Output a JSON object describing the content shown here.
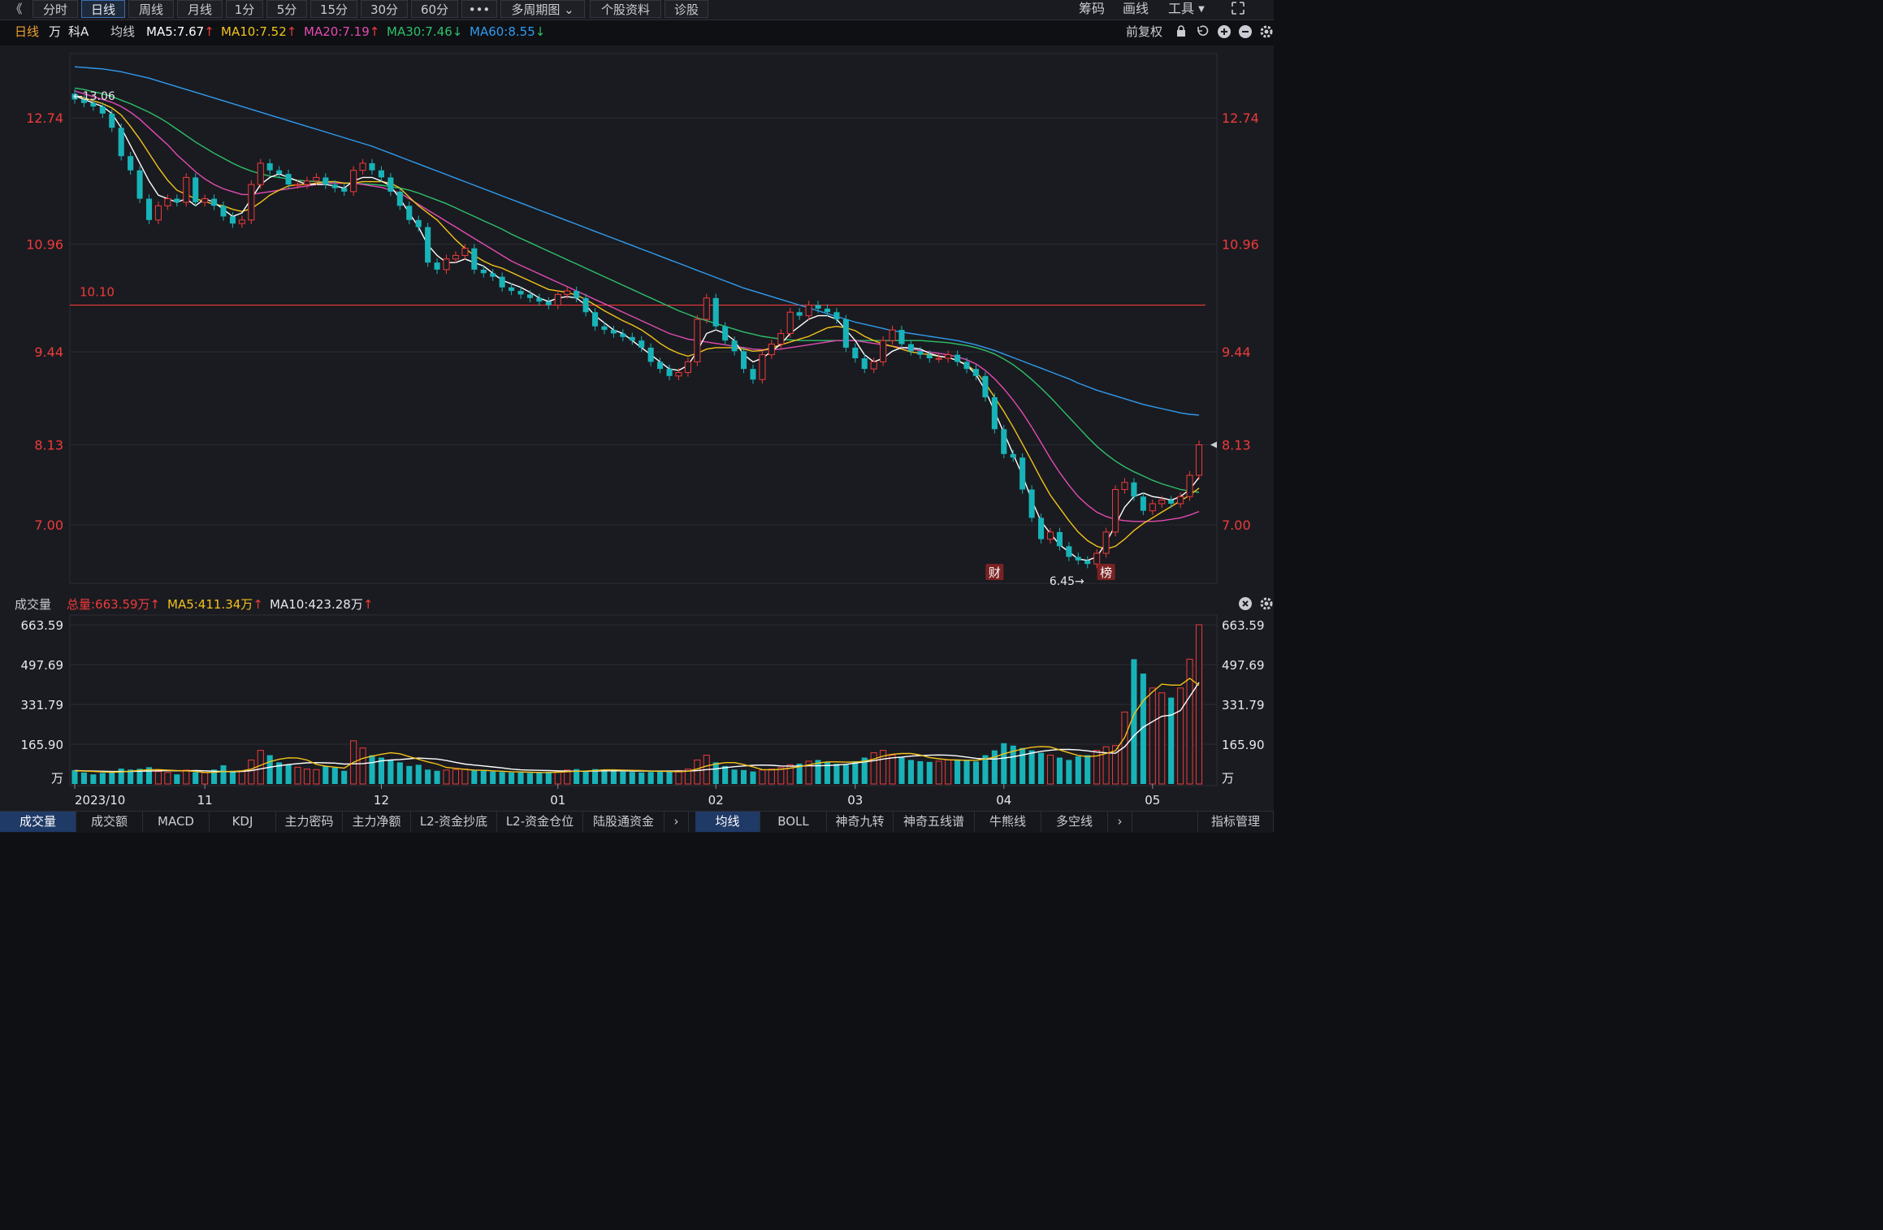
{
  "top_tabs": {
    "collapse": "《",
    "items": [
      "分时",
      "日线",
      "周线",
      "月线",
      "1分",
      "5分",
      "15分",
      "30分",
      "60分",
      "•••",
      "多周期图 ⌄",
      "个股资料",
      "诊股"
    ],
    "active": "日线"
  },
  "top_right": {
    "chip": "筹码",
    "draw": "画线",
    "tools": "工具",
    "expand_icon": "expand-icon"
  },
  "legend": {
    "period": "日线",
    "unit": "万",
    "stock": "科A",
    "ma_label": "均线",
    "ma5": "MA5:7.67",
    "ma10": "MA10:7.52",
    "ma20": "MA20:7.19",
    "ma30": "MA30:7.46",
    "ma60": "MA60:8.55",
    "fq": "前复权"
  },
  "colors": {
    "up": "#ee3b3b",
    "down": "#18b3b8",
    "ma5": "#ffffff",
    "ma10": "#f2c21c",
    "ma20": "#e24bb3",
    "ma30": "#2ec06a",
    "ma60": "#2f9bf0",
    "grid": "#2a2c33",
    "axis_label": "#ee3b3b",
    "bg": "#1a1b20"
  },
  "price_axis": {
    "ticks": [
      "12.74",
      "10.96",
      "9.44",
      "8.13",
      "7.00"
    ]
  },
  "annotations": {
    "high": "←13.06",
    "low": "6.45→",
    "hline": "10.10",
    "marker_cai": "财",
    "marker_bang": "榜"
  },
  "volume_legend": {
    "title": "成交量",
    "total": "总量:663.59万",
    "ma5": "MA5:411.34万",
    "ma10": "MA10:423.28万"
  },
  "volume_axis": {
    "ticks": [
      "663.59",
      "497.69",
      "331.79",
      "165.90",
      "万"
    ]
  },
  "date_axis": [
    "2023/10",
    "11",
    "12",
    "01",
    "02",
    "03",
    "04",
    "05"
  ],
  "bottom_left_tabs": [
    "成交量",
    "成交额",
    "MACD",
    "KDJ",
    "主力密码",
    "主力净额",
    "L2-资金抄底",
    "L2-资金仓位",
    "陆股通资金"
  ],
  "bottom_right_tabs": [
    "均线",
    "BOLL",
    "神奇九转",
    "神奇五线谱",
    "牛熊线",
    "多空线"
  ],
  "bottom_extra": "指标管理",
  "chart_data": {
    "type": "candlestick",
    "price_ylim": [
      6.2,
      13.6
    ],
    "volume_ylim": [
      0,
      663.59
    ],
    "hline": 10.1,
    "closes": [
      13.0,
      12.95,
      12.9,
      12.8,
      12.6,
      12.2,
      12.0,
      11.6,
      11.3,
      11.5,
      11.6,
      11.55,
      11.9,
      11.55,
      11.6,
      11.5,
      11.35,
      11.25,
      11.3,
      11.8,
      12.1,
      12.0,
      11.95,
      11.8,
      11.8,
      11.85,
      11.9,
      11.8,
      11.75,
      11.7,
      12.0,
      12.1,
      12.0,
      11.9,
      11.7,
      11.5,
      11.3,
      11.2,
      10.7,
      10.6,
      10.75,
      10.8,
      10.9,
      10.6,
      10.55,
      10.5,
      10.35,
      10.3,
      10.25,
      10.2,
      10.15,
      10.1,
      10.25,
      10.3,
      10.2,
      10.0,
      9.8,
      9.75,
      9.7,
      9.65,
      9.6,
      9.5,
      9.3,
      9.2,
      9.1,
      9.15,
      9.3,
      9.9,
      10.2,
      9.8,
      9.6,
      9.45,
      9.2,
      9.05,
      9.4,
      9.55,
      9.7,
      10.0,
      9.95,
      10.1,
      10.05,
      10.0,
      9.9,
      9.5,
      9.35,
      9.2,
      9.3,
      9.6,
      9.75,
      9.55,
      9.45,
      9.4,
      9.35,
      9.35,
      9.4,
      9.3,
      9.2,
      9.1,
      8.8,
      8.35,
      8.0,
      7.95,
      7.5,
      7.1,
      6.8,
      6.9,
      6.7,
      6.55,
      6.5,
      6.45,
      6.6,
      6.9,
      7.5,
      7.6,
      7.4,
      7.2,
      7.3,
      7.35,
      7.3,
      7.4,
      7.7,
      8.13
    ],
    "volumes": [
      58,
      48,
      40,
      46,
      54,
      64,
      60,
      63,
      70,
      52,
      48,
      40,
      58,
      49,
      47,
      60,
      78,
      55,
      52,
      100,
      140,
      120,
      90,
      80,
      70,
      62,
      60,
      75,
      68,
      55,
      180,
      150,
      120,
      110,
      100,
      90,
      75,
      80,
      60,
      55,
      58,
      60,
      62,
      56,
      55,
      52,
      50,
      48,
      48,
      46,
      47,
      48,
      52,
      58,
      62,
      55,
      62,
      60,
      58,
      52,
      50,
      48,
      50,
      52,
      55,
      56,
      62,
      100,
      120,
      90,
      75,
      60,
      58,
      52,
      58,
      62,
      68,
      80,
      85,
      95,
      100,
      90,
      84,
      80,
      95,
      110,
      130,
      140,
      120,
      110,
      100,
      95,
      92,
      95,
      100,
      102,
      98,
      94,
      120,
      140,
      170,
      160,
      150,
      140,
      130,
      120,
      110,
      100,
      115,
      120,
      140,
      155,
      160,
      300,
      520,
      460,
      400,
      380,
      360,
      400,
      520,
      663.59
    ],
    "ma5": [
      13.05,
      13.0,
      12.95,
      12.9,
      12.8,
      12.6,
      12.35,
      12.1,
      11.85,
      11.65,
      11.6,
      11.55,
      11.6,
      11.5,
      11.6,
      11.55,
      11.45,
      11.35,
      11.4,
      11.6,
      11.8,
      11.9,
      11.95,
      11.9,
      11.85,
      11.8,
      11.8,
      11.8,
      11.78,
      11.75,
      11.85,
      11.9,
      11.9,
      11.85,
      11.78,
      11.6,
      11.4,
      11.2,
      10.95,
      10.8,
      10.7,
      10.7,
      10.75,
      10.7,
      10.65,
      10.55,
      10.45,
      10.4,
      10.35,
      10.28,
      10.2,
      10.15,
      10.2,
      10.22,
      10.2,
      10.1,
      9.95,
      9.85,
      9.75,
      9.7,
      9.6,
      9.5,
      9.4,
      9.3,
      9.2,
      9.18,
      9.25,
      9.45,
      9.7,
      9.75,
      9.7,
      9.6,
      9.4,
      9.3,
      9.35,
      9.45,
      9.55,
      9.7,
      9.8,
      9.9,
      9.95,
      9.95,
      9.9,
      9.75,
      9.6,
      9.4,
      9.3,
      9.35,
      9.45,
      9.5,
      9.5,
      9.48,
      9.42,
      9.38,
      9.36,
      9.32,
      9.25,
      9.12,
      8.9,
      8.6,
      8.3,
      8.0,
      7.7,
      7.35,
      7.05,
      6.88,
      6.72,
      6.62,
      6.52,
      6.5,
      6.55,
      6.75,
      7.0,
      7.25,
      7.4,
      7.45,
      7.4,
      7.38,
      7.35,
      7.4,
      7.5,
      7.67
    ],
    "ma10": [
      13.06,
      13.02,
      12.98,
      12.94,
      12.88,
      12.78,
      12.62,
      12.44,
      12.24,
      12.04,
      11.86,
      11.72,
      11.66,
      11.6,
      11.56,
      11.52,
      11.5,
      11.45,
      11.42,
      11.46,
      11.55,
      11.65,
      11.72,
      11.78,
      11.8,
      11.8,
      11.82,
      11.84,
      11.84,
      11.82,
      11.82,
      11.84,
      11.84,
      11.84,
      11.82,
      11.75,
      11.62,
      11.5,
      11.4,
      11.3,
      11.16,
      11.02,
      10.9,
      10.8,
      10.72,
      10.66,
      10.62,
      10.56,
      10.5,
      10.44,
      10.38,
      10.32,
      10.3,
      10.28,
      10.24,
      10.18,
      10.1,
      10.02,
      9.95,
      9.88,
      9.82,
      9.75,
      9.66,
      9.56,
      9.48,
      9.42,
      9.38,
      9.42,
      9.48,
      9.5,
      9.5,
      9.5,
      9.48,
      9.45,
      9.46,
      9.5,
      9.54,
      9.58,
      9.62,
      9.66,
      9.72,
      9.78,
      9.8,
      9.78,
      9.74,
      9.66,
      9.6,
      9.55,
      9.52,
      9.48,
      9.44,
      9.42,
      9.4,
      9.38,
      9.36,
      9.32,
      9.26,
      9.16,
      9.0,
      8.8,
      8.6,
      8.38,
      8.14,
      7.9,
      7.65,
      7.42,
      7.24,
      7.06,
      6.9,
      6.78,
      6.7,
      6.66,
      6.7,
      6.8,
      6.92,
      7.02,
      7.1,
      7.18,
      7.26,
      7.34,
      7.42,
      7.52
    ],
    "ma20": [
      13.12,
      13.08,
      13.04,
      13.0,
      12.96,
      12.9,
      12.82,
      12.72,
      12.6,
      12.48,
      12.36,
      12.22,
      12.1,
      11.98,
      11.88,
      11.8,
      11.74,
      11.7,
      11.66,
      11.66,
      11.68,
      11.7,
      11.72,
      11.74,
      11.76,
      11.78,
      11.8,
      11.82,
      11.82,
      11.82,
      11.82,
      11.8,
      11.78,
      11.76,
      11.72,
      11.68,
      11.6,
      11.52,
      11.44,
      11.36,
      11.28,
      11.2,
      11.12,
      11.04,
      10.96,
      10.88,
      10.8,
      10.72,
      10.66,
      10.6,
      10.54,
      10.48,
      10.42,
      10.36,
      10.3,
      10.24,
      10.18,
      10.12,
      10.06,
      10.0,
      9.94,
      9.88,
      9.82,
      9.76,
      9.7,
      9.66,
      9.62,
      9.6,
      9.58,
      9.56,
      9.54,
      9.52,
      9.5,
      9.48,
      9.47,
      9.47,
      9.48,
      9.5,
      9.52,
      9.54,
      9.56,
      9.58,
      9.6,
      9.6,
      9.6,
      9.58,
      9.56,
      9.54,
      9.52,
      9.5,
      9.48,
      9.46,
      9.44,
      9.42,
      9.4,
      9.37,
      9.33,
      9.27,
      9.18,
      9.06,
      8.92,
      8.76,
      8.58,
      8.38,
      8.16,
      7.94,
      7.74,
      7.56,
      7.4,
      7.28,
      7.18,
      7.12,
      7.08,
      7.06,
      7.05,
      7.05,
      7.05,
      7.06,
      7.08,
      7.1,
      7.14,
      7.19
    ],
    "ma30": [
      13.16,
      13.14,
      13.11,
      13.08,
      13.04,
      12.99,
      12.94,
      12.88,
      12.82,
      12.75,
      12.67,
      12.58,
      12.49,
      12.4,
      12.32,
      12.24,
      12.17,
      12.1,
      12.04,
      11.99,
      11.95,
      11.92,
      11.9,
      11.88,
      11.86,
      11.85,
      11.84,
      11.83,
      11.82,
      11.82,
      11.82,
      11.81,
      11.8,
      11.79,
      11.77,
      11.75,
      11.72,
      11.68,
      11.63,
      11.58,
      11.53,
      11.47,
      11.41,
      11.35,
      11.29,
      11.23,
      11.17,
      11.1,
      11.04,
      10.98,
      10.92,
      10.86,
      10.8,
      10.74,
      10.68,
      10.62,
      10.56,
      10.5,
      10.44,
      10.38,
      10.32,
      10.26,
      10.2,
      10.14,
      10.08,
      10.02,
      9.97,
      9.92,
      9.88,
      9.84,
      9.8,
      9.76,
      9.72,
      9.69,
      9.66,
      9.64,
      9.62,
      9.61,
      9.6,
      9.6,
      9.6,
      9.6,
      9.6,
      9.6,
      9.6,
      9.6,
      9.6,
      9.6,
      9.6,
      9.6,
      9.6,
      9.6,
      9.59,
      9.58,
      9.57,
      9.55,
      9.53,
      9.5,
      9.46,
      9.41,
      9.34,
      9.26,
      9.16,
      9.05,
      8.93,
      8.8,
      8.66,
      8.52,
      8.38,
      8.24,
      8.11,
      8.0,
      7.9,
      7.82,
      7.75,
      7.69,
      7.63,
      7.58,
      7.54,
      7.5,
      7.48,
      7.46
    ],
    "ma60": [
      13.46,
      13.45,
      13.44,
      13.43,
      13.41,
      13.39,
      13.36,
      13.33,
      13.3,
      13.26,
      13.22,
      13.18,
      13.14,
      13.1,
      13.06,
      13.02,
      12.98,
      12.94,
      12.9,
      12.86,
      12.82,
      12.78,
      12.74,
      12.7,
      12.66,
      12.62,
      12.58,
      12.54,
      12.5,
      12.46,
      12.42,
      12.38,
      12.34,
      12.29,
      12.24,
      12.19,
      12.14,
      12.09,
      12.04,
      11.99,
      11.94,
      11.89,
      11.84,
      11.79,
      11.74,
      11.69,
      11.64,
      11.59,
      11.54,
      11.49,
      11.44,
      11.39,
      11.34,
      11.29,
      11.24,
      11.19,
      11.14,
      11.09,
      11.04,
      10.99,
      10.94,
      10.89,
      10.84,
      10.79,
      10.74,
      10.69,
      10.64,
      10.59,
      10.54,
      10.49,
      10.44,
      10.39,
      10.34,
      10.3,
      10.26,
      10.22,
      10.18,
      10.14,
      10.1,
      10.06,
      10.02,
      9.98,
      9.94,
      9.9,
      9.86,
      9.83,
      9.8,
      9.77,
      9.74,
      9.72,
      9.7,
      9.68,
      9.66,
      9.64,
      9.62,
      9.6,
      9.57,
      9.54,
      9.5,
      9.46,
      9.41,
      9.36,
      9.31,
      9.26,
      9.21,
      9.16,
      9.11,
      9.06,
      9.0,
      8.95,
      8.9,
      8.86,
      8.82,
      8.78,
      8.74,
      8.7,
      8.67,
      8.64,
      8.61,
      8.58,
      8.56,
      8.55
    ],
    "vol_ma5": [
      55,
      54,
      52,
      50,
      49,
      50,
      53,
      57,
      59,
      60,
      58,
      56,
      55,
      52,
      48,
      48,
      52,
      52,
      55,
      62,
      78,
      93,
      103,
      109,
      108,
      100,
      82,
      74,
      70,
      66,
      90,
      107,
      116,
      124,
      130,
      126,
      114,
      103,
      92,
      83,
      69,
      65,
      61,
      58,
      57,
      55,
      53,
      51,
      50,
      49,
      48,
      48,
      49,
      51,
      53,
      54,
      56,
      59,
      59,
      58,
      57,
      56,
      54,
      53,
      52,
      51,
      53,
      63,
      75,
      83,
      89,
      89,
      81,
      71,
      60,
      59,
      61,
      66,
      72,
      80,
      87,
      92,
      92,
      91,
      91,
      95,
      104,
      116,
      124,
      127,
      127,
      121,
      110,
      105,
      101,
      100,
      99,
      99,
      104,
      112,
      126,
      136,
      146,
      153,
      156,
      154,
      142,
      130,
      119,
      114,
      117,
      127,
      138,
      194,
      290,
      347,
      384,
      416,
      412,
      412,
      440,
      411.34
    ],
    "vol_ma10": [
      56,
      55,
      54,
      53,
      52,
      52,
      52,
      53,
      54,
      55,
      56,
      55,
      55,
      56,
      55,
      53,
      52,
      51,
      52,
      56,
      63,
      70,
      76,
      81,
      85,
      88,
      89,
      88,
      87,
      83,
      84,
      85,
      89,
      96,
      100,
      102,
      105,
      108,
      106,
      104,
      98,
      90,
      83,
      79,
      75,
      71,
      67,
      62,
      59,
      58,
      57,
      56,
      55,
      54,
      53,
      53,
      54,
      55,
      55,
      55,
      54,
      54,
      54,
      54,
      54,
      54,
      54,
      56,
      60,
      63,
      68,
      72,
      75,
      78,
      79,
      78,
      75,
      74,
      75,
      76,
      76,
      77,
      79,
      82,
      87,
      92,
      97,
      104,
      109,
      112,
      116,
      118,
      120,
      121,
      120,
      117,
      112,
      107,
      104,
      104,
      108,
      113,
      121,
      129,
      136,
      141,
      144,
      144,
      142,
      138,
      133,
      130,
      128,
      155,
      201,
      237,
      260,
      282,
      287,
      306,
      365,
      423.28
    ]
  }
}
